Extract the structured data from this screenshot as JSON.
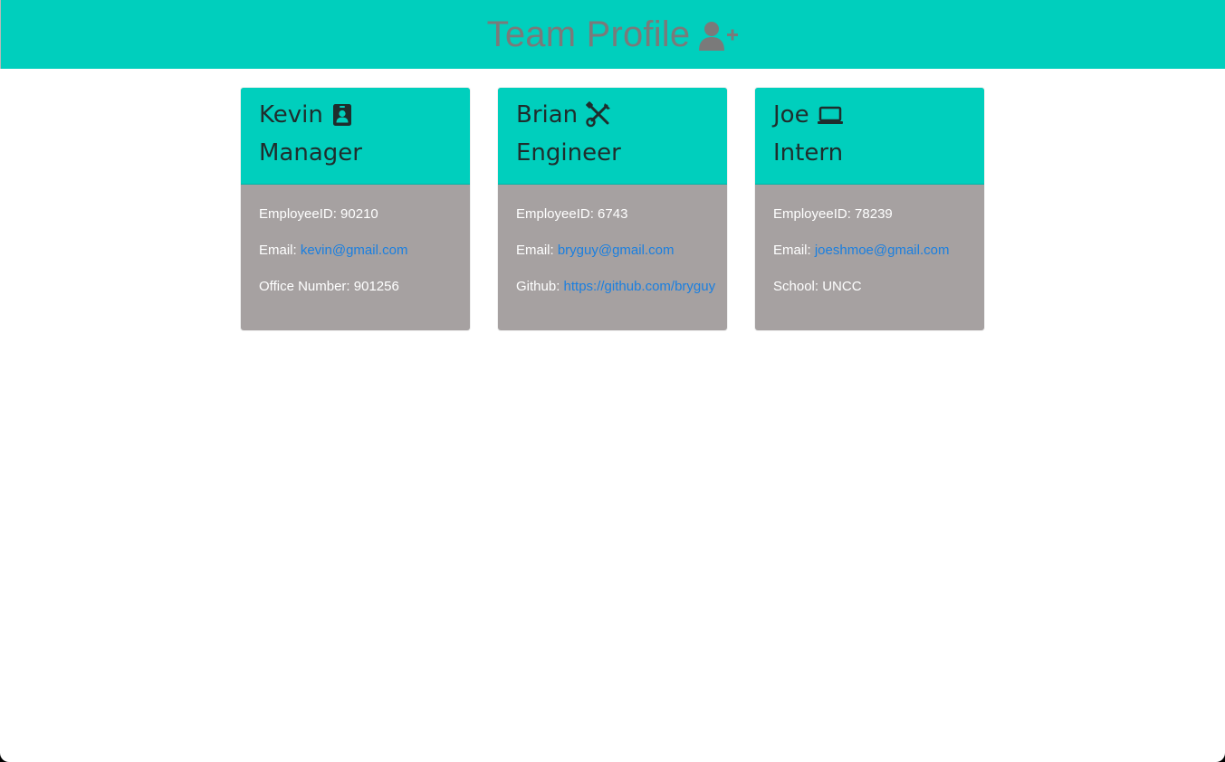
{
  "header": {
    "title": "Team Profile",
    "icon": "user-plus-icon"
  },
  "colors": {
    "accent": "#00cfbd",
    "card_body": "#a6a1a1",
    "link": "#1a7fe0",
    "title_text": "#7a7a7a"
  },
  "cards": [
    {
      "name": "Kevin",
      "role": "Manager",
      "icon": "id-badge-icon",
      "id_label": "EmployeeID: ",
      "id_value": "90210",
      "email_label": "Email: ",
      "email": "kevin@gmail.com",
      "extra_label": "Office Number: ",
      "extra_value": "901256"
    },
    {
      "name": "Brian",
      "role": "Engineer",
      "icon": "tools-icon",
      "id_label": "EmployeeID: ",
      "id_value": "6743",
      "email_label": "Email: ",
      "email": "bryguy@gmail.com",
      "extra_label": "Github: ",
      "extra_value": "https://github.com/bryguy"
    },
    {
      "name": "Joe",
      "role": "Intern",
      "icon": "laptop-icon",
      "id_label": "EmployeeID: ",
      "id_value": "78239",
      "email_label": "Email: ",
      "email": "joeshmoe@gmail.com",
      "extra_label": "School: ",
      "extra_value": "UNCC"
    }
  ]
}
